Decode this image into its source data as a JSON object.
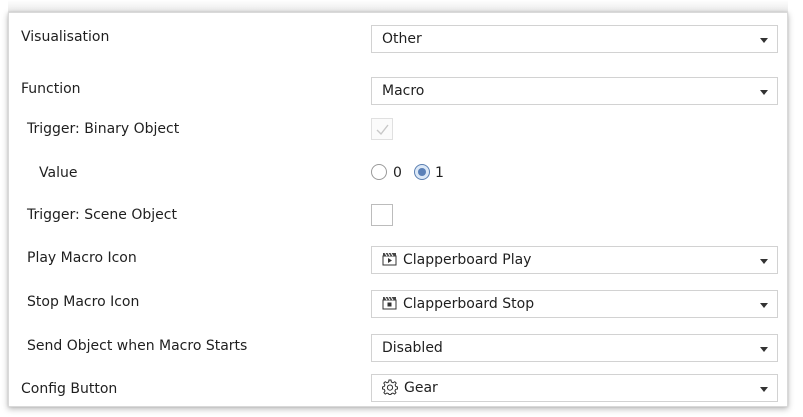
{
  "rows": {
    "visualisation": {
      "label": "Visualisation",
      "value": "Other"
    },
    "function": {
      "label": "Function",
      "value": "Macro"
    },
    "trigger_binary": {
      "label": "Trigger: Binary Object",
      "checked": true,
      "enabled": false
    },
    "value": {
      "label": "Value",
      "options": [
        "0",
        "1"
      ],
      "selected": "1"
    },
    "trigger_scene": {
      "label": "Trigger: Scene Object",
      "checked": false
    },
    "play_macro_icon": {
      "label": "Play Macro Icon",
      "value": "Clapperboard Play",
      "icon": "clapperboard-play-icon"
    },
    "stop_macro_icon": {
      "label": "Stop Macro Icon",
      "value": "Clapperboard Stop",
      "icon": "clapperboard-stop-icon"
    },
    "send_object": {
      "label": "Send Object when Macro Starts",
      "value": "Disabled"
    },
    "config_button": {
      "label": "Config Button",
      "value": "Gear",
      "icon": "gear-icon"
    }
  },
  "colors": {
    "border": "#d2d2d2",
    "radio_accent": "#5a80b8",
    "text": "#1f1f1f"
  }
}
